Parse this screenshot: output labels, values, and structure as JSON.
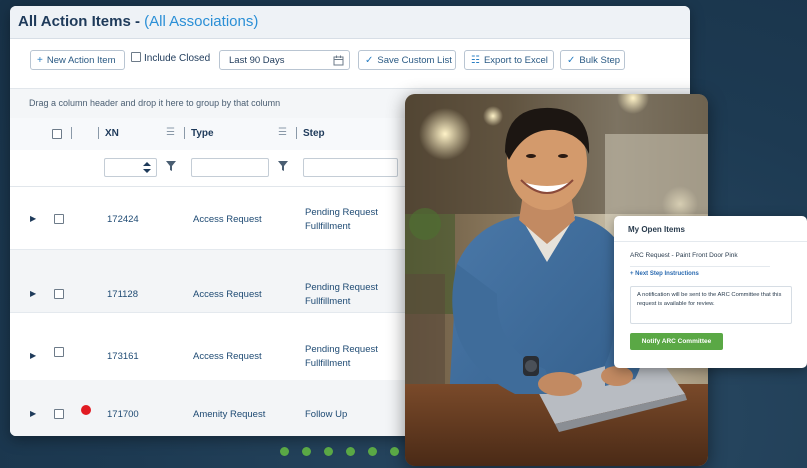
{
  "header": {
    "title": "All Action Items - ",
    "subtitle": "(All Associations)"
  },
  "toolbar": {
    "new_action_item": "New Action Item",
    "include_closed": "Include Closed",
    "date_range": "Last 90 Days",
    "save_custom_list": "Save Custom List",
    "export_to_excel": "Export to Excel",
    "bulk_step": "Bulk Step"
  },
  "group_hint": "Drag a column header and drop it here to group by that column",
  "columns": {
    "xn": "XN",
    "type": "Type",
    "step": "Step"
  },
  "rows": [
    {
      "xn": "172424",
      "type": "Access Request",
      "step_line1": "Pending Request",
      "step_line2": "Fullfillment",
      "flag": false
    },
    {
      "xn": "171128",
      "type": "Access Request",
      "step_line1": "Pending Request",
      "step_line2": "Fullfillment",
      "flag": false
    },
    {
      "xn": "173161",
      "type": "Access Request",
      "step_line1": "Pending Request",
      "step_line2": "Fullfillment",
      "flag": false
    },
    {
      "xn": "171700",
      "type": "Amenity Request",
      "step_line1": "Follow Up",
      "step_line2": "",
      "flag": true
    }
  ],
  "open_items": {
    "title": "My Open Items",
    "item": "ARC Request - Paint Front Door Pink",
    "next_step": "+ Next Step Instructions",
    "note": "A notification will be sent to the ARC Committee that this request is available for review.",
    "button": "Notify ARC Committee"
  },
  "colors": {
    "background": "#1d3a52",
    "accent_blue": "#2a8fd6",
    "action_green": "#5aa845",
    "flag_red": "#e11b22"
  },
  "icons": {
    "new": "plus-icon",
    "date": "calendar-icon",
    "save": "check-circle-icon",
    "export": "excel-file-icon",
    "bulk": "check-circle-icon",
    "filter": "funnel-icon",
    "expand": "caret-right-icon"
  }
}
